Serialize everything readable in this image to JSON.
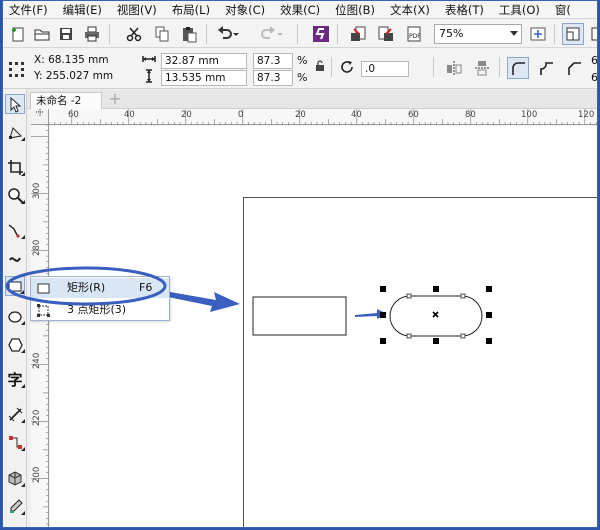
{
  "menubar": {
    "items": [
      "文件(F)",
      "编辑(E)",
      "视图(V)",
      "布局(L)",
      "对象(C)",
      "效果(C)",
      "位图(B)",
      "文本(X)",
      "表格(T)",
      "工具(O)",
      "窗("
    ]
  },
  "toolbar": {
    "zoom_value": "75%",
    "icons": [
      "new-icon",
      "open-icon",
      "save-icon",
      "print-icon",
      "cut-icon",
      "copy-icon",
      "paste-icon",
      "undo-icon",
      "redo-icon",
      "app-launcher-icon",
      "import-icon",
      "export-icon",
      "publish-pdf-icon",
      "full-screen-icon",
      "snap-icon"
    ]
  },
  "propbar": {
    "x_label": "X: 68.135 mm",
    "y_label": "Y: 255.027 mm",
    "width_value": "32.87 mm",
    "height_value": "13.535 mm",
    "scale_x": "87.3",
    "scale_y": "87.3",
    "pct_symbol": "%",
    "rotation_value": ".0",
    "right_edge_1": "6",
    "right_edge_2": "6"
  },
  "tabs": {
    "doc_tab_label": "未命名 -2",
    "add_tab": "+"
  },
  "rulers": {
    "h_numbers": [
      "60",
      "40",
      "20",
      "0",
      "20",
      "40",
      "60",
      "80",
      "100",
      "120"
    ],
    "v_numbers": [
      "300",
      "280",
      "260",
      "240",
      "220",
      "200"
    ]
  },
  "flyout": {
    "items": [
      {
        "label": "矩形(R)",
        "key": "F6"
      },
      {
        "label": "3 点矩形(3)",
        "key": ""
      }
    ]
  },
  "toolbox": {
    "text_tool_glyph": "字"
  },
  "colors": {
    "accent": "#2b55a6",
    "annotation": "#3a5fbf",
    "highlight": "#d8e6f6"
  }
}
